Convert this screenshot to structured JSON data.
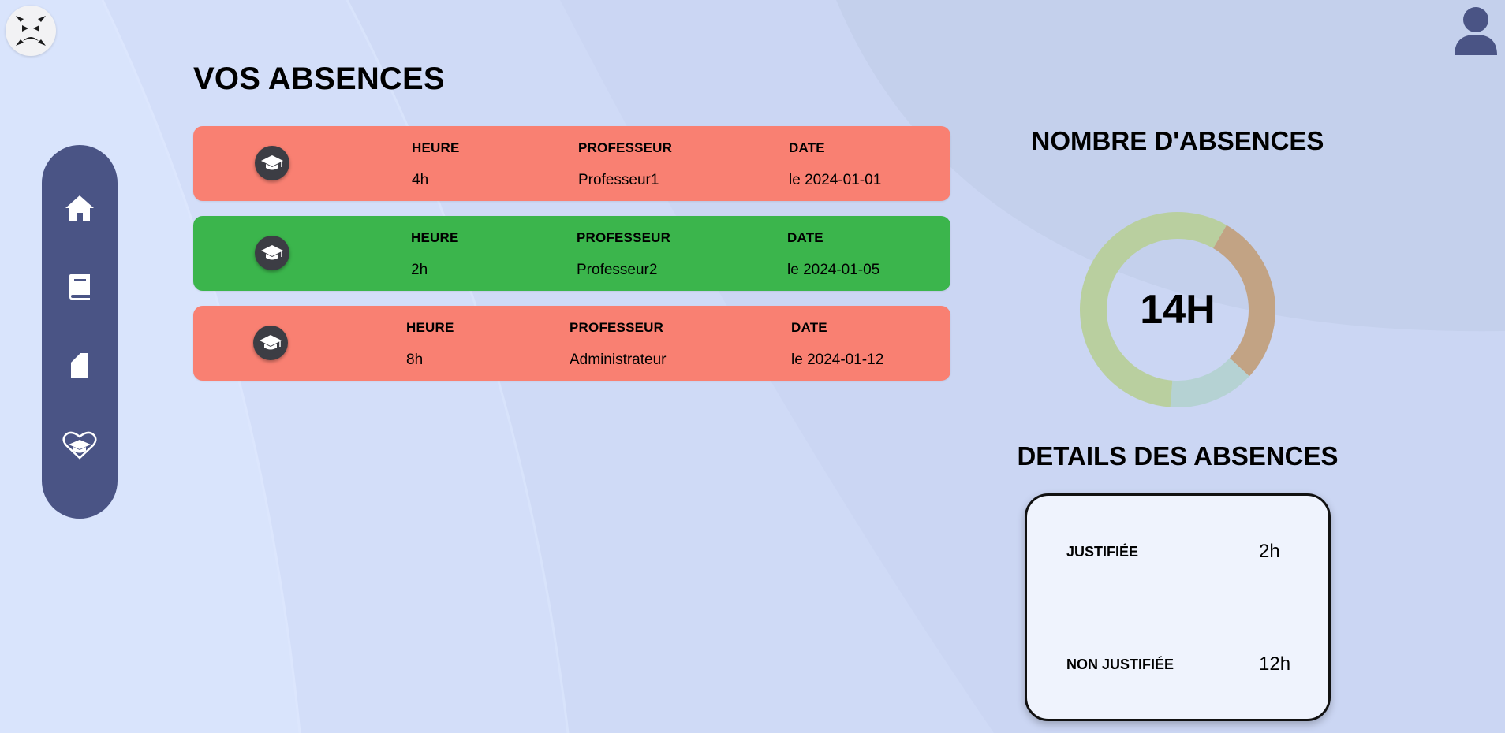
{
  "app": {
    "logo_icon": "frustrated-face-icon",
    "avatar_icon": "user-avatar-icon"
  },
  "sidebar": {
    "items": [
      {
        "name": "home",
        "icon": "home-icon"
      },
      {
        "name": "courses",
        "icon": "book-icon"
      },
      {
        "name": "documents",
        "icon": "document-icon"
      },
      {
        "name": "absences",
        "icon": "graduation-heart-icon"
      }
    ]
  },
  "main": {
    "title": "VOS ABSENCES",
    "columns": {
      "hours": "HEURE",
      "teacher": "PROFESSEUR",
      "date": "DATE"
    },
    "absences": [
      {
        "hours": "4h",
        "teacher": "Professeur1",
        "date": "le 2024-01-01",
        "status": "non-justified",
        "color": "#f98072"
      },
      {
        "hours": "2h",
        "teacher": "Professeur2",
        "date": "le 2024-01-05",
        "status": "justified",
        "color": "#3bb54c"
      },
      {
        "hours": "8h",
        "teacher": "Administrateur",
        "date": "le 2024-01-12",
        "status": "non-justified",
        "color": "#f98072"
      }
    ]
  },
  "summary": {
    "count_title": "NOMBRE D'ABSENCES",
    "total": "14H",
    "segments": [
      {
        "hours": 4,
        "color": "#c2a384"
      },
      {
        "hours": 2,
        "color": "#b5d2d3"
      },
      {
        "hours": 8,
        "color": "#b9cf9f"
      }
    ],
    "details_title": "DETAILS DES ABSENCES",
    "justified_label": "JUSTIFIÉE",
    "justified_value": "2h",
    "unjustified_label": "NON JUSTIFIÉE",
    "unjustified_value": "12h"
  }
}
